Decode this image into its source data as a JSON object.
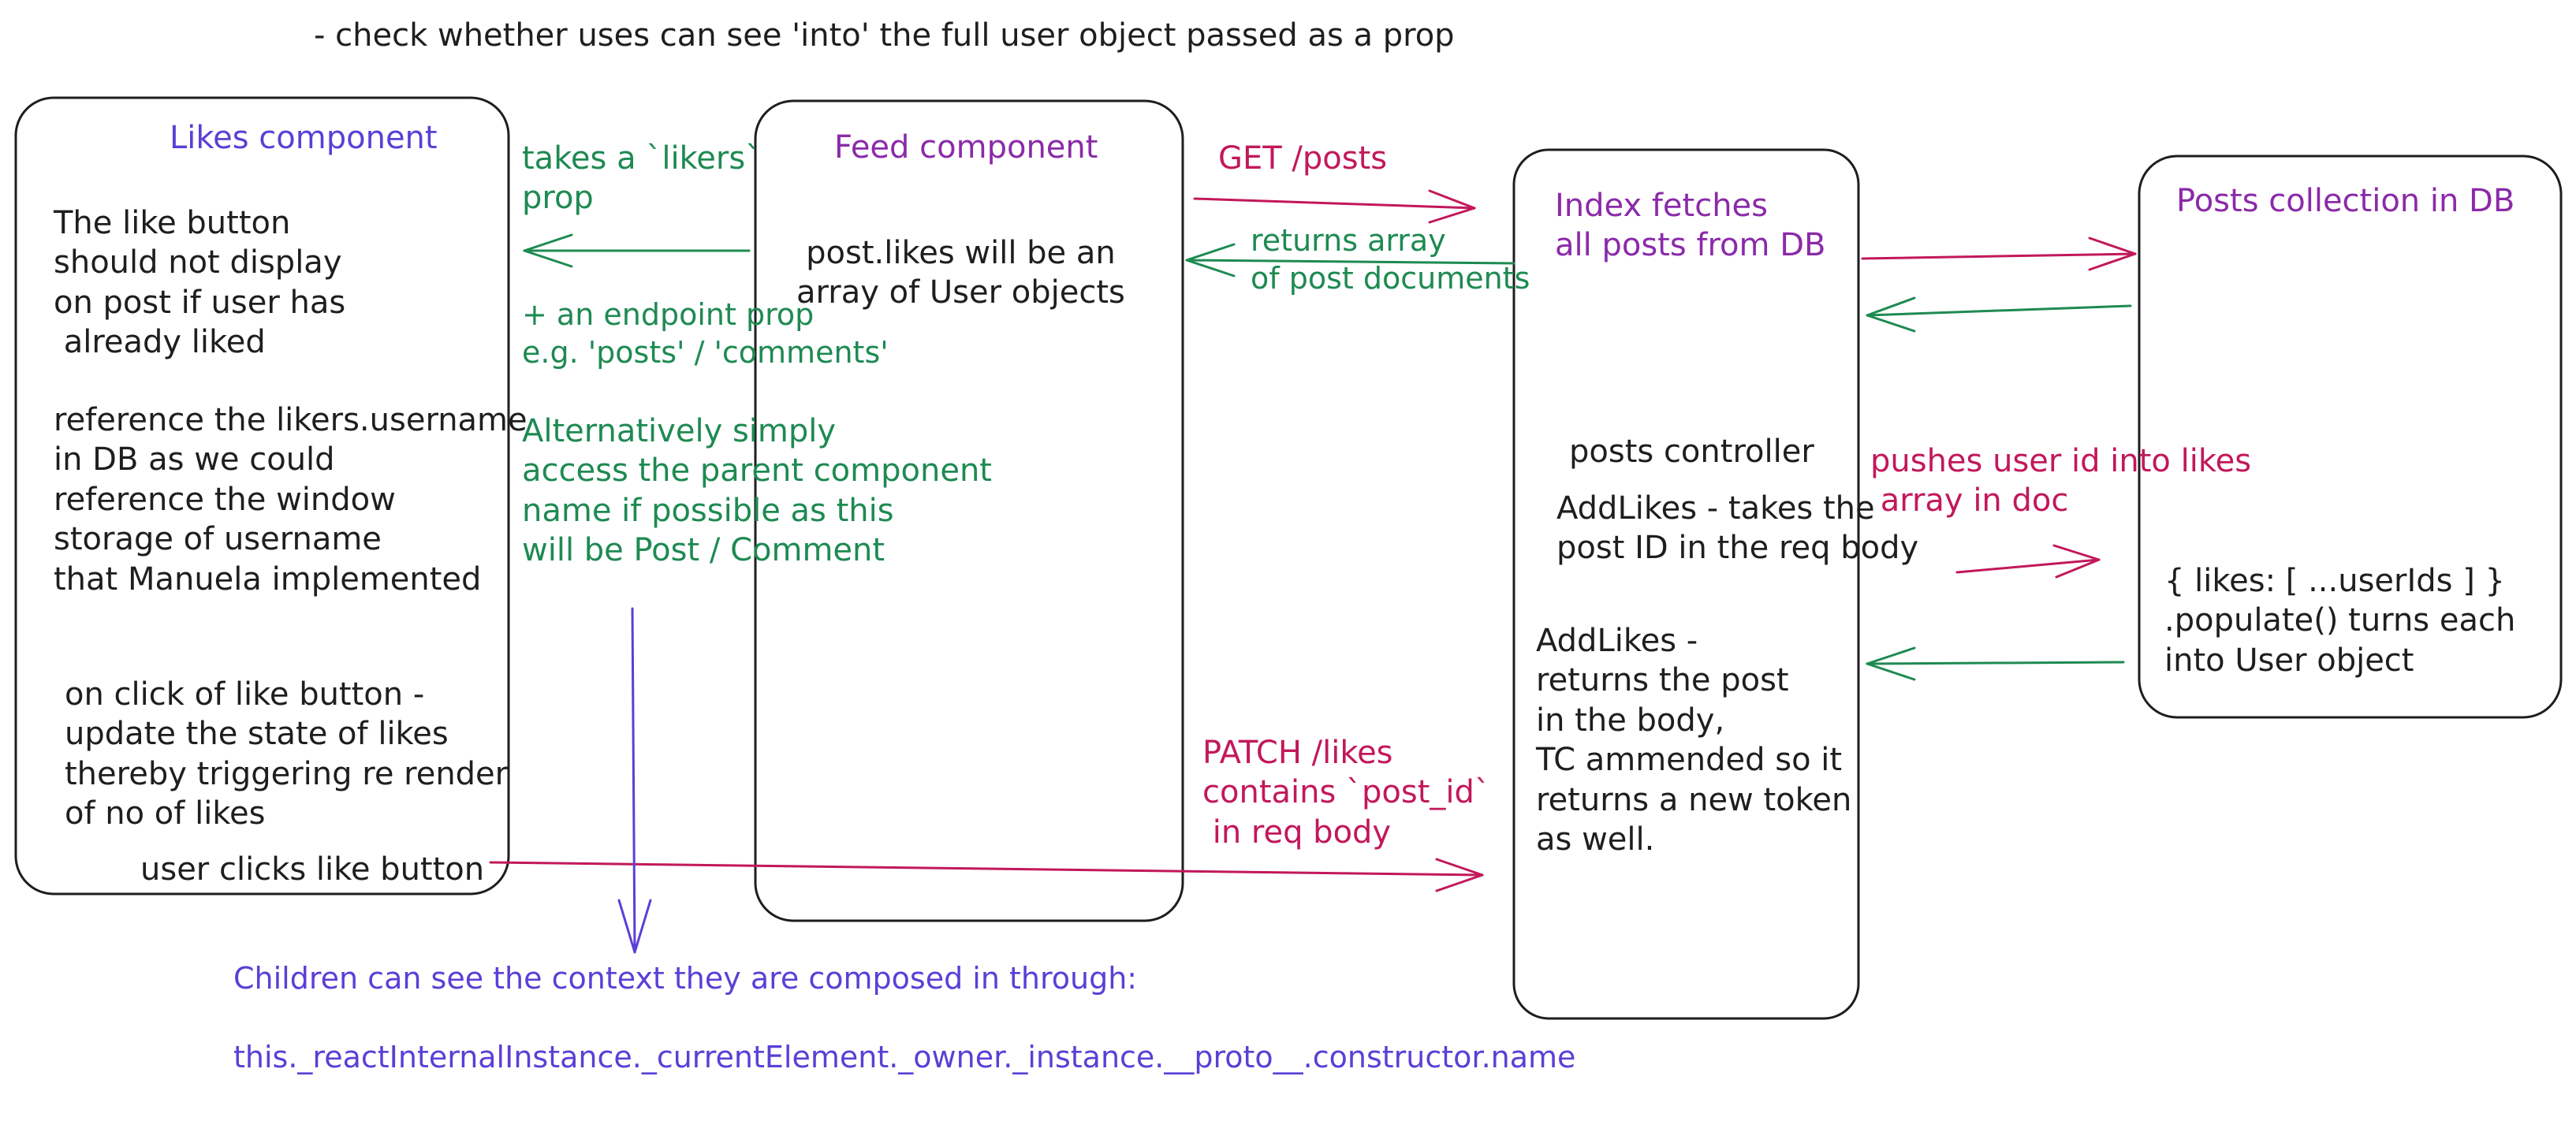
{
  "top_note": "- check whether uses can see 'into' the full user object passed as a prop",
  "likes_component": {
    "title": "Likes component",
    "note_display": "The like button\nshould not display\non post if user has\n already liked",
    "note_reference": "reference the likers.username\nin DB as we could\nreference the window\nstorage of username\nthat Manuela implemented",
    "note_click": "on click of like button -\nupdate the state of likes\nthereby triggering re render\nof no of likes",
    "user_clicks": "user clicks like button"
  },
  "props_notes": {
    "takes_likers": "takes a `likers`\nprop",
    "endpoint_prop": "+ an endpoint prop\ne.g. 'posts' / 'comments'",
    "alternatively": "Alternatively simply\naccess the parent component\nname if possible as this\nwill be Post / Comment"
  },
  "feed_component": {
    "title": "Feed component",
    "note": "post.likes will be an\narray of User objects"
  },
  "requests": {
    "get_posts": "GET /posts",
    "returns_array": "returns array\nof post documents",
    "patch_likes": "PATCH /likes\ncontains `post_id`\n in req body"
  },
  "controller": {
    "index": "Index fetches\nall posts from DB",
    "posts_controller": "posts controller",
    "addlikes_takes": "AddLikes - takes the\npost ID in the req body",
    "addlikes_returns": "AddLikes -\nreturns the post\nin the body,\nTC ammended so it\nreturns a new token\nas well."
  },
  "db": {
    "pushes": "pushes user id into likes\n array in doc",
    "title": "Posts collection in DB",
    "note": "{ likes: [ ...userIds ] }\n.populate() turns each\ninto User object"
  },
  "children_note": {
    "line1": "Children can see the context they are composed in through:",
    "line2": "this._reactInternalInstance._currentElement._owner._instance.__proto__.constructor.name"
  },
  "colors": {
    "stroke": "#1e1e1e",
    "purple": "#8b2aa9",
    "indigo": "#5b3fd6",
    "green": "#1e8a52",
    "crimson": "#c2185b"
  }
}
